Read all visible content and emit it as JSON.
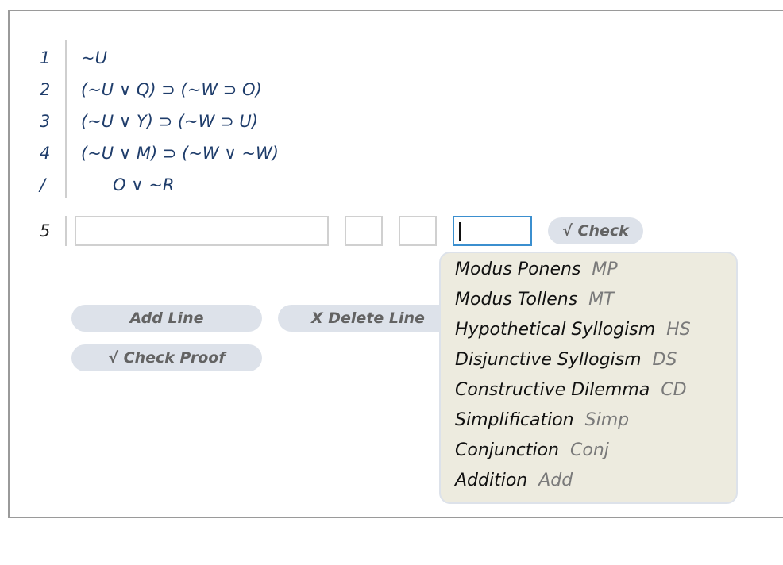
{
  "proof": {
    "premises": [
      {
        "number": "1",
        "formula": "~U"
      },
      {
        "number": "2",
        "formula": "(~U ∨ Q) ⊃ (~W ⊃ O)"
      },
      {
        "number": "3",
        "formula": "(~U ∨ Y) ⊃ (~W ⊃ U)"
      },
      {
        "number": "4",
        "formula": "(~U ∨ M) ⊃ (~W ∨ ~W)"
      }
    ],
    "conclusion": {
      "marker": "/",
      "formula": "O ∨ ~R"
    },
    "new_line": {
      "number": "5",
      "formula_value": "",
      "line_ref_1_value": "",
      "line_ref_2_value": "",
      "rule_value": "",
      "check_label": "√ Check"
    }
  },
  "buttons": {
    "add_line": "Add Line",
    "delete_line": "X  Delete Line",
    "check_proof": "√  Check Proof"
  },
  "rule_dropdown": {
    "items": [
      {
        "name": "Modus Ponens",
        "abbr": "MP"
      },
      {
        "name": "Modus Tollens",
        "abbr": "MT"
      },
      {
        "name": "Hypothetical Syllogism",
        "abbr": "HS"
      },
      {
        "name": "Disjunctive Syllogism",
        "abbr": "DS"
      },
      {
        "name": "Constructive Dilemma",
        "abbr": "CD"
      },
      {
        "name": "Simplification",
        "abbr": "Simp"
      },
      {
        "name": "Conjunction",
        "abbr": "Conj"
      },
      {
        "name": "Addition",
        "abbr": "Add"
      }
    ]
  },
  "colors": {
    "formula_text": "#1f3d6b",
    "button_bg": "#dde2ea",
    "dropdown_bg": "#edebdf",
    "focus_border": "#3b8fcf"
  }
}
